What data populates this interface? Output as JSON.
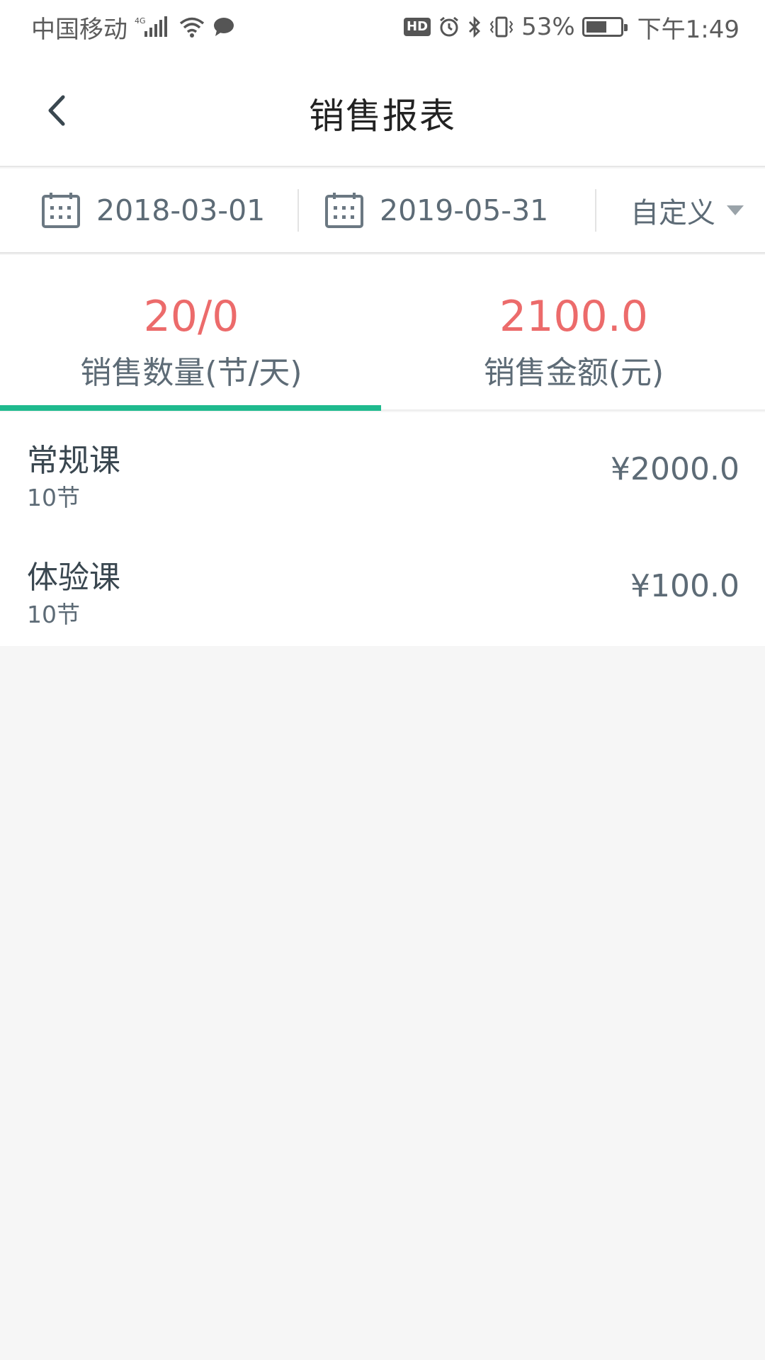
{
  "status_bar": {
    "carrier": "中国移动",
    "network": "4G",
    "battery": "53%",
    "battery_level": 0.53,
    "time": "下午1:49",
    "hd": "HD"
  },
  "header": {
    "title": "销售报表"
  },
  "filter": {
    "start_date": "2018-03-01",
    "end_date": "2019-05-31",
    "range_label": "自定义"
  },
  "summary": {
    "tabs": [
      {
        "value": "20/0",
        "label": "销售数量(节/天)",
        "active": true
      },
      {
        "value": "2100.0",
        "label": "销售金额(元)",
        "active": false
      }
    ]
  },
  "list": {
    "items": [
      {
        "name": "常规课",
        "count": "10节",
        "amount": "¥2000.0"
      },
      {
        "name": "体验课",
        "count": "10节",
        "amount": "¥100.0"
      }
    ]
  },
  "colors": {
    "accent": "#1fba8e",
    "highlight": "#ec6b6b",
    "text_secondary": "#5d6b76",
    "background": "#f6f6f6"
  }
}
